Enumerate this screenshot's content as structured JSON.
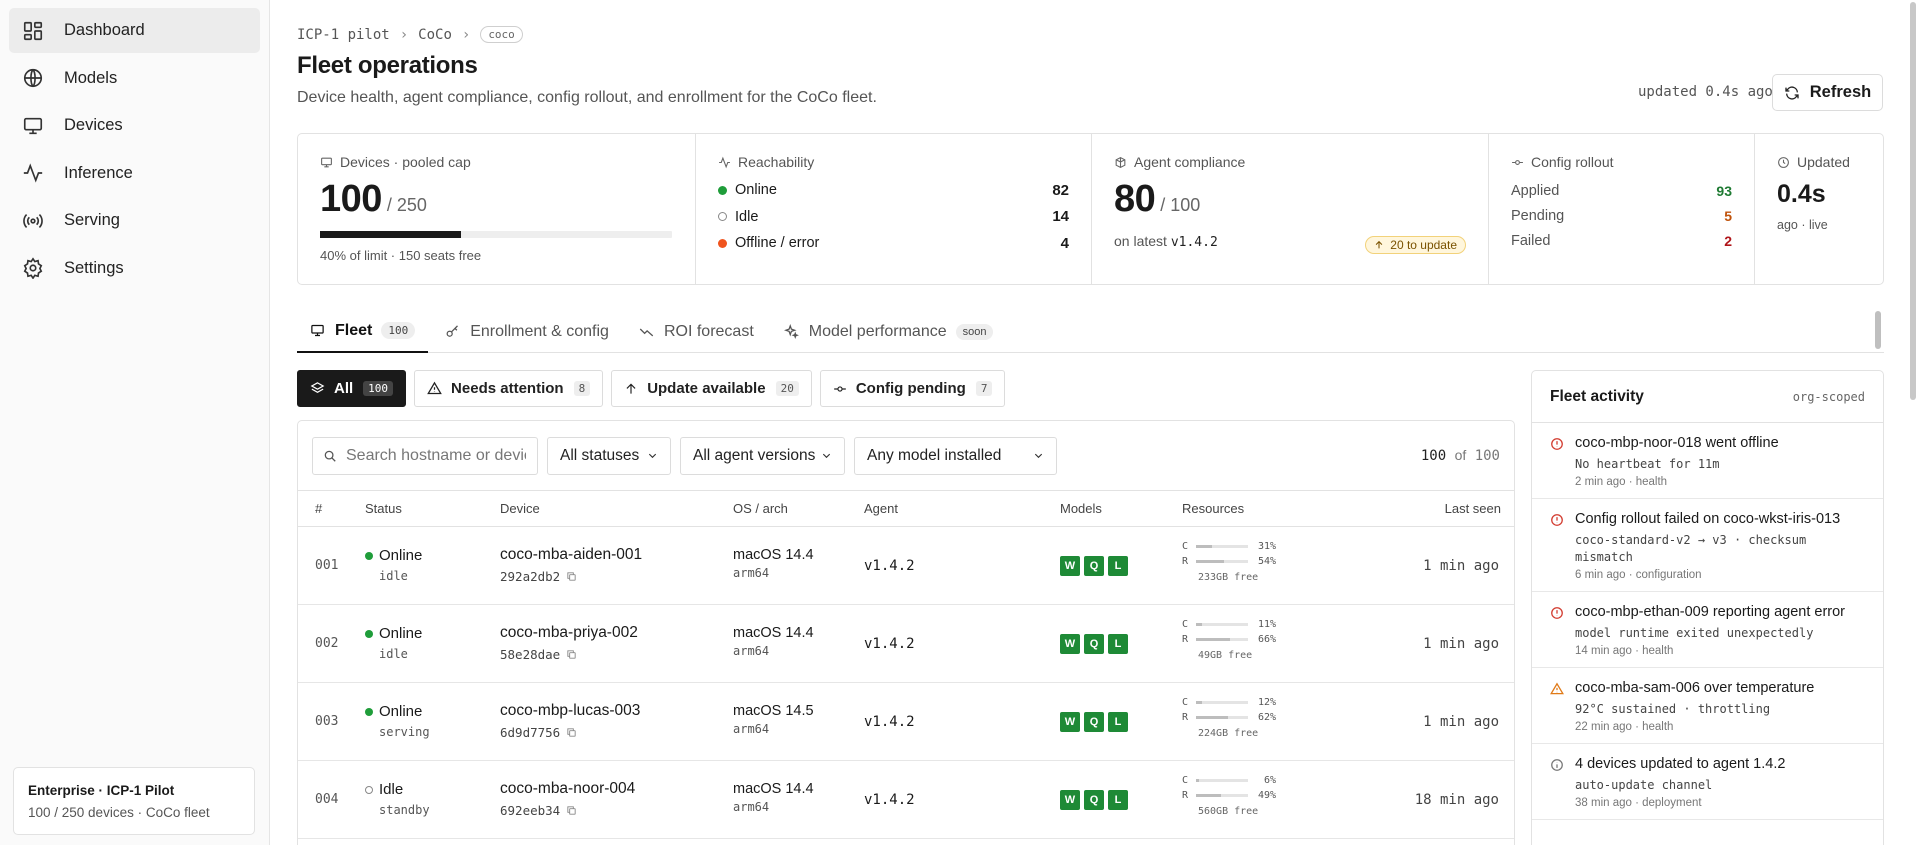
{
  "sidebar": {
    "items": [
      {
        "label": "Dashboard",
        "icon": "dashboard-icon",
        "active": true
      },
      {
        "label": "Models",
        "icon": "globe-icon",
        "active": false
      },
      {
        "label": "Devices",
        "icon": "monitor-icon",
        "active": false
      },
      {
        "label": "Inference",
        "icon": "pulse-icon",
        "active": false
      },
      {
        "label": "Serving",
        "icon": "broadcast-icon",
        "active": false
      },
      {
        "label": "Settings",
        "icon": "gear-icon",
        "active": false
      }
    ],
    "plan": {
      "title": "Enterprise · ICP-1 Pilot",
      "subtitle": "100 / 250 devices · CoCo fleet"
    }
  },
  "header": {
    "breadcrumb": [
      "ICP-1 pilot",
      "CoCo",
      "coco"
    ],
    "title": "Fleet operations",
    "description": "Device health, agent compliance, config rollout, and enrollment for the CoCo fleet.",
    "updated": "updated 0.4s ago",
    "refresh_label": "Refresh"
  },
  "stats": {
    "devices": {
      "label": "Devices · pooled cap",
      "value": "100",
      "of": "/ 250",
      "fill": 0.4,
      "note": "40% of limit · 150 seats free"
    },
    "reachability": {
      "label": "Reachability",
      "rows": [
        {
          "label": "Online",
          "value": "82",
          "color": "#1f9d3a"
        },
        {
          "label": "Idle",
          "value": "14",
          "color": "#ffffff"
        },
        {
          "label": "Offline / error",
          "value": "4",
          "color": "#f0541e"
        }
      ]
    },
    "compliance": {
      "label": "Agent compliance",
      "value": "80",
      "of": "/ 100",
      "note_prefix": "on latest",
      "version": "v1.4.2",
      "chip": "20 to update"
    },
    "rollout": {
      "label": "Config rollout",
      "rows": [
        {
          "label": "Applied",
          "value": "93",
          "color": "#1e7a32"
        },
        {
          "label": "Pending",
          "value": "5",
          "color": "#c0530c"
        },
        {
          "label": "Failed",
          "value": "2",
          "color": "#b0151a"
        }
      ]
    },
    "updated": {
      "label": "Updated",
      "value": "0.4s",
      "note": "ago · live"
    }
  },
  "tabs": [
    {
      "label": "Fleet",
      "badge": "100",
      "icon": "monitor-icon",
      "active": true
    },
    {
      "label": "Enrollment & config",
      "badge": "",
      "icon": "key-icon",
      "active": false
    },
    {
      "label": "ROI forecast",
      "badge": "",
      "icon": "trend-icon",
      "active": false
    },
    {
      "label": "Model performance",
      "badge": "soon",
      "icon": "sparkle-icon",
      "active": false
    }
  ],
  "filters": [
    {
      "label": "All",
      "count": "100",
      "active": true
    },
    {
      "label": "Needs attention",
      "count": "8",
      "active": false
    },
    {
      "label": "Update available",
      "count": "20",
      "active": false
    },
    {
      "label": "Config pending",
      "count": "7",
      "active": false
    }
  ],
  "toolbar": {
    "search_placeholder": "Search hostname or device",
    "status_select": "All statuses",
    "agent_select": "All agent versions",
    "model_select": "Any model installed",
    "count_shown": "100",
    "count_of": "of",
    "count_total": "100"
  },
  "columns": [
    "#",
    "Status",
    "Device",
    "OS / arch",
    "Agent",
    "Models",
    "Resources",
    "Last seen"
  ],
  "rows": [
    {
      "num": "001",
      "status": "Online",
      "status_color": "#1f9d3a",
      "sub": "idle",
      "name": "coco-mba-aiden-001",
      "id": "292a2db2",
      "os": "macOS 14.4",
      "arch": "arm64",
      "agent": "v1.4.2",
      "models": [
        "W",
        "Q",
        "L"
      ],
      "cpu": "31%",
      "cpu_v": 31,
      "ram": "54%",
      "ram_v": 54,
      "free": "233GB free",
      "last": "1 min ago"
    },
    {
      "num": "002",
      "status": "Online",
      "status_color": "#1f9d3a",
      "sub": "idle",
      "name": "coco-mba-priya-002",
      "id": "58e28dae",
      "os": "macOS 14.4",
      "arch": "arm64",
      "agent": "v1.4.2",
      "models": [
        "W",
        "Q",
        "L"
      ],
      "cpu": "11%",
      "cpu_v": 11,
      "ram": "66%",
      "ram_v": 66,
      "free": "49GB free",
      "last": "1 min ago"
    },
    {
      "num": "003",
      "status": "Online",
      "status_color": "#1f9d3a",
      "sub": "serving",
      "name": "coco-mbp-lucas-003",
      "id": "6d9d7756",
      "os": "macOS 14.5",
      "arch": "arm64",
      "agent": "v1.4.2",
      "models": [
        "W",
        "Q",
        "L"
      ],
      "cpu": "12%",
      "cpu_v": 12,
      "ram": "62%",
      "ram_v": 62,
      "free": "224GB free",
      "last": "1 min ago"
    },
    {
      "num": "004",
      "status": "Idle",
      "status_color": "#ffffff",
      "sub": "standby",
      "name": "coco-mba-noor-004",
      "id": "692eeb34",
      "os": "macOS 14.4",
      "arch": "arm64",
      "agent": "v1.4.2",
      "models": [
        "W",
        "Q",
        "L"
      ],
      "cpu": "6%",
      "cpu_v": 6,
      "ram": "49%",
      "ram_v": 49,
      "free": "560GB free",
      "last": "18 min ago"
    }
  ],
  "activity": {
    "title": "Fleet activity",
    "scope": "org-scoped",
    "items": [
      {
        "type": "error",
        "title": "coco-mbp-noor-018 went offline",
        "detail": "No heartbeat for 11m",
        "meta": "2 min ago · health"
      },
      {
        "type": "error",
        "title": "Config rollout failed on coco-wkst-iris-013",
        "detail": "coco-standard-v2 → v3 · checksum mismatch",
        "meta": "6 min ago · configuration"
      },
      {
        "type": "error",
        "title": "coco-mbp-ethan-009 reporting agent error",
        "detail": "model runtime exited unexpectedly",
        "meta": "14 min ago · health"
      },
      {
        "type": "warning",
        "title": "coco-mba-sam-006 over temperature",
        "detail": "92°C sustained · throttling",
        "meta": "22 min ago · health"
      },
      {
        "type": "info",
        "title": "4 devices updated to agent 1.4.2",
        "detail": "auto-update channel",
        "meta": "38 min ago · deployment"
      }
    ]
  },
  "colors": {
    "online": "#1f9d3a",
    "offline": "#f0541e",
    "model_badge": "#1e8a36",
    "error": "#d23b2f",
    "warning": "#e07a18"
  }
}
